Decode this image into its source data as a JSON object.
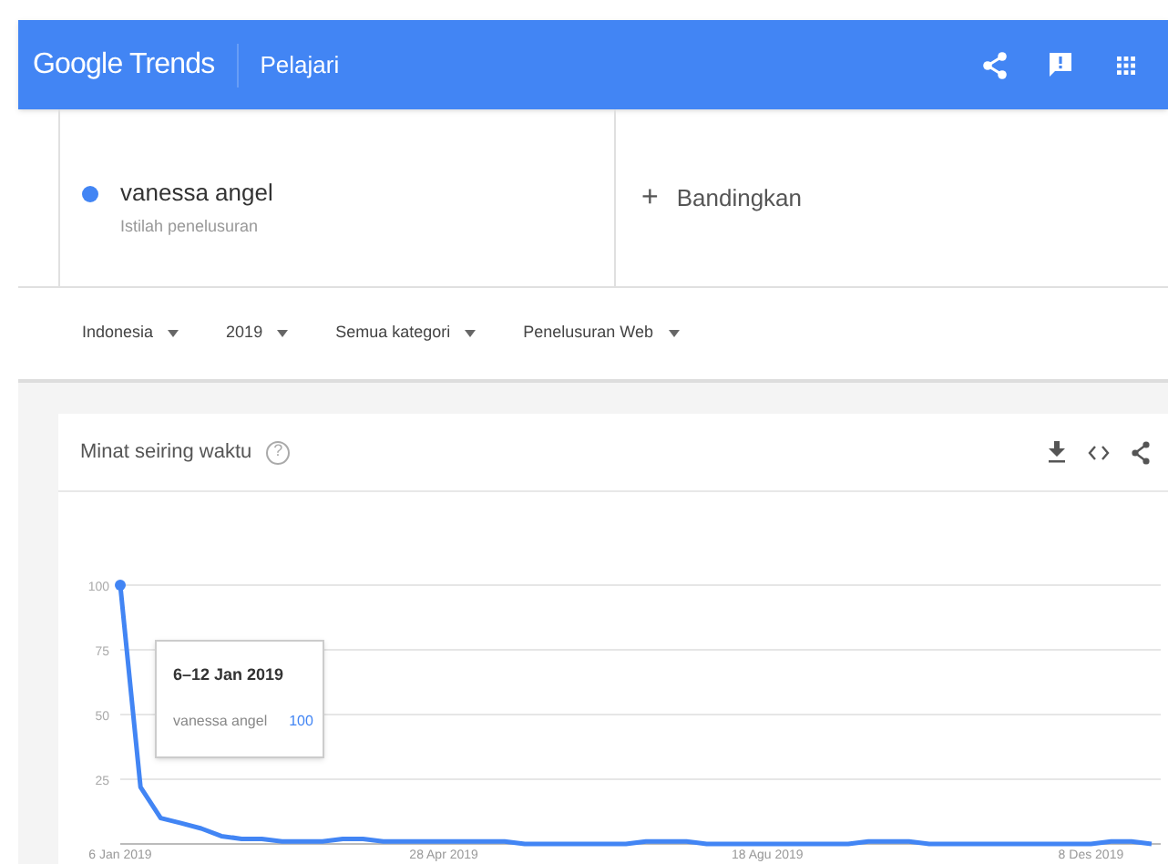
{
  "header": {
    "logo": "Google Trends",
    "section": "Pelajari"
  },
  "search_term": {
    "term": "vanessa angel",
    "subtitle": "Istilah penelusuran",
    "color": "#4285f4"
  },
  "compare": {
    "label": "Bandingkan",
    "icon": "+"
  },
  "filters": [
    {
      "label": "Indonesia"
    },
    {
      "label": "2019"
    },
    {
      "label": "Semua kategori"
    },
    {
      "label": "Penelusuran Web"
    }
  ],
  "card": {
    "title": "Minat seiring waktu",
    "help": "?",
    "tooltip": {
      "date": "6–12 Jan 2019",
      "value": "100"
    },
    "chart_data": {
      "type": "line",
      "categories": [
        "6 Jan 2019",
        null,
        null,
        null,
        null,
        null,
        null,
        null,
        null,
        null,
        null,
        null,
        null,
        null,
        null,
        null,
        "28 Apr 2019",
        null,
        null,
        null,
        null,
        null,
        null,
        null,
        null,
        null,
        null,
        null,
        null,
        null,
        null,
        null,
        "18 Agu 2019",
        null,
        null,
        null,
        null,
        null,
        null,
        null,
        null,
        null,
        null,
        null,
        null,
        null,
        null,
        null,
        "8 Des 2019",
        null,
        null,
        null
      ],
      "grid": true,
      "series": [
        {
          "name": "vanessa angel",
          "color": "#4285f4",
          "values": [
            100,
            22,
            10,
            8,
            6,
            3,
            2,
            2,
            1,
            1,
            1,
            2,
            2,
            1,
            1,
            1,
            1,
            1,
            1,
            1,
            0,
            0,
            0,
            0,
            0,
            0,
            1,
            1,
            1,
            0,
            0,
            0,
            0,
            0,
            0,
            0,
            0,
            1,
            1,
            1,
            0,
            0,
            0,
            0,
            0,
            0,
            0,
            0,
            0,
            1,
            1,
            0
          ]
        }
      ],
      "ylim": [
        0,
        100
      ],
      "yticks": [
        25,
        50,
        75,
        100
      ]
    }
  }
}
